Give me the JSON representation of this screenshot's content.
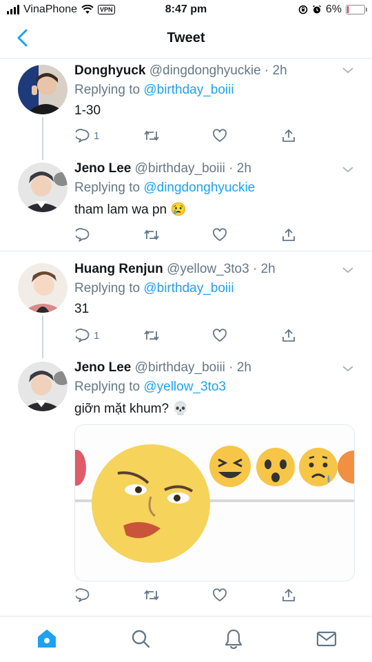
{
  "status_bar": {
    "carrier": "VinaPhone",
    "vpn": "VPN",
    "time": "8:47 pm",
    "battery": "6%"
  },
  "nav": {
    "title": "Tweet"
  },
  "tweets": [
    {
      "name": "Donghyuck",
      "handle": "@dingdonghyuckie · 2h",
      "replying_prefix": "Replying to",
      "replying_to": "@birthday_boiii",
      "text": "1-30",
      "reply_count": "1",
      "emoji": ""
    },
    {
      "name": "Jeno Lee",
      "handle": "@birthday_boiii · 2h",
      "replying_prefix": "Replying to",
      "replying_to": "@dingdonghyuckie",
      "text": "tham lam wa pn",
      "reply_count": "",
      "emoji": "😢"
    },
    {
      "name": "Huang Renjun",
      "handle": "@yellow_3to3 · 2h",
      "replying_prefix": "Replying to",
      "replying_to": "@birthday_boiii",
      "text": "31",
      "reply_count": "1",
      "emoji": ""
    },
    {
      "name": "Jeno Lee",
      "handle": "@birthday_boiii · 2h",
      "replying_prefix": "Replying to",
      "replying_to": "@yellow_3to3",
      "text": "giỡn mặt khum?",
      "reply_count": "",
      "emoji": "💀"
    }
  ],
  "colors": {
    "accent": "#1da1f2",
    "muted": "#657786",
    "divider": "#e1e8ed",
    "battery_low": "#e0245e"
  },
  "icons": [
    "back-chevron-icon",
    "reply-icon",
    "retweet-icon",
    "like-icon",
    "share-icon",
    "home-icon",
    "search-icon",
    "notifications-icon",
    "messages-icon"
  ]
}
